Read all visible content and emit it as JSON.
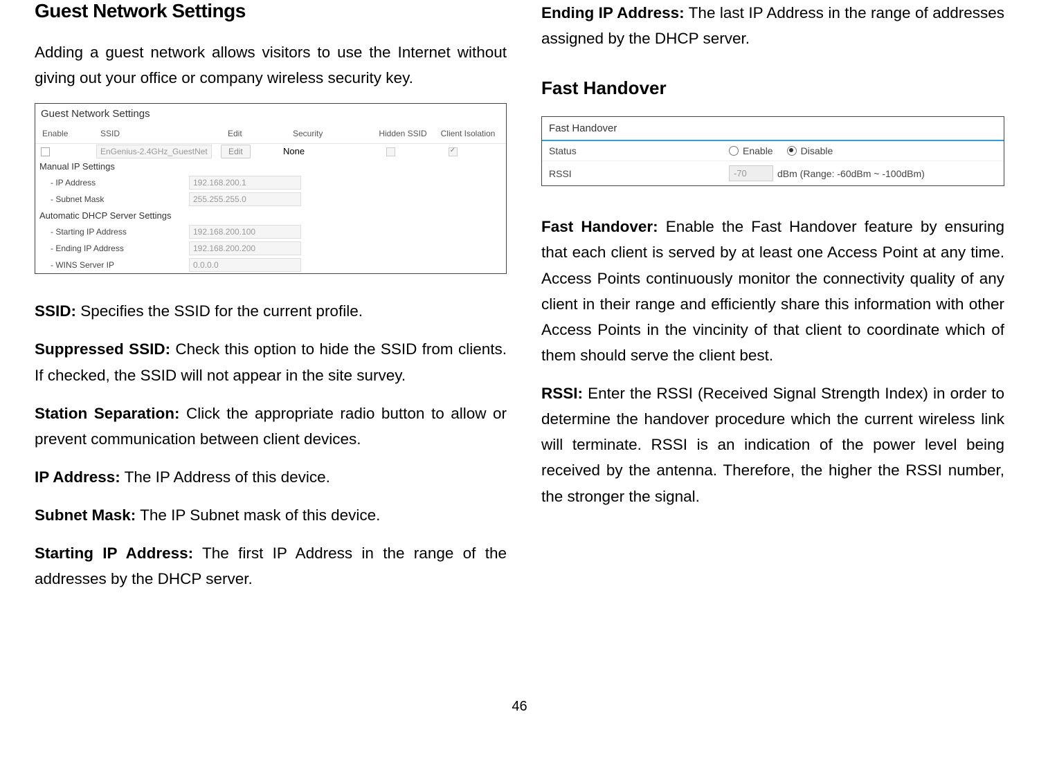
{
  "page_number": "46",
  "left": {
    "heading": "Guest Network Settings",
    "intro": "Adding a guest network allows visitors to use the Internet without giving out your office or company wireless security key.",
    "table": {
      "title": "Guest Network Settings",
      "head": {
        "enable": "Enable",
        "ssid": "SSID",
        "edit": "Edit",
        "security": "Security",
        "hidden": "Hidden SSID",
        "isolation": "Client Isolation"
      },
      "row": {
        "ssid_value": "EnGenius-2.4GHz_GuestNet",
        "edit_btn": "Edit",
        "security_val": "None"
      },
      "manual_hdr": "Manual IP Settings",
      "ip_addr_label": "- IP Address",
      "ip_addr_val": "192.168.200.1",
      "subnet_label": "- Subnet Mask",
      "subnet_val": "255.255.255.0",
      "dhcp_hdr": "Automatic DHCP Server Settings",
      "start_label": "- Starting IP Address",
      "start_val": "192.168.200.100",
      "end_label": "- Ending IP Address",
      "end_val": "192.168.200.200",
      "wins_label": "- WINS Server IP",
      "wins_val": "0.0.0.0"
    },
    "ssid_term": "SSID:",
    "ssid_desc": " Specifies the SSID for the current profile.",
    "supp_term": "Suppressed SSID:",
    "supp_desc": " Check this option to hide the SSID from clients. If checked, the SSID will not appear in the site survey.",
    "station_term": "Station Separation:",
    "station_desc": " Click the appropriate radio button to allow or prevent communication between client devices.",
    "ipaddr_term": "IP Address:",
    "ipaddr_desc": " The IP Address of this device.",
    "subnet_term": "Subnet Mask:",
    "subnet_desc": " The IP Subnet mask of this device.",
    "startip_term": "Starting IP Address:",
    "startip_desc": " The first IP Address in the range of the addresses by the DHCP server."
  },
  "right": {
    "endip_term": "Ending IP Address:",
    "endip_desc": " The last IP Address in the range of addresses assigned by the DHCP server.",
    "fh_heading": "Fast Handover",
    "fh_table": {
      "title": "Fast Handover",
      "status_label": "Status",
      "enable_label": "Enable",
      "disable_label": "Disable",
      "rssi_label": "RSSI",
      "rssi_val": "-70",
      "rssi_suffix": "dBm (Range: -60dBm ~ -100dBm)"
    },
    "fh_term": "Fast Handover:",
    "fh_desc": " Enable the Fast Handover feature by ensuring that each client is served by at least one Access Point at any time. Access Points continuously monitor the connectivity quality of any client in their range and efficiently share this information with other Access Points in the vincinity of that client to coordinate which of them should serve the client best.",
    "rssi_term": "RSSI:",
    "rssi_desc": " Enter the RSSI (Received Signal Strength Index) in order to determine the handover procedure which the current wireless link will terminate. RSSI is an indication of the power level being received by the antenna. Therefore, the higher the RSSI number, the stronger the signal."
  }
}
